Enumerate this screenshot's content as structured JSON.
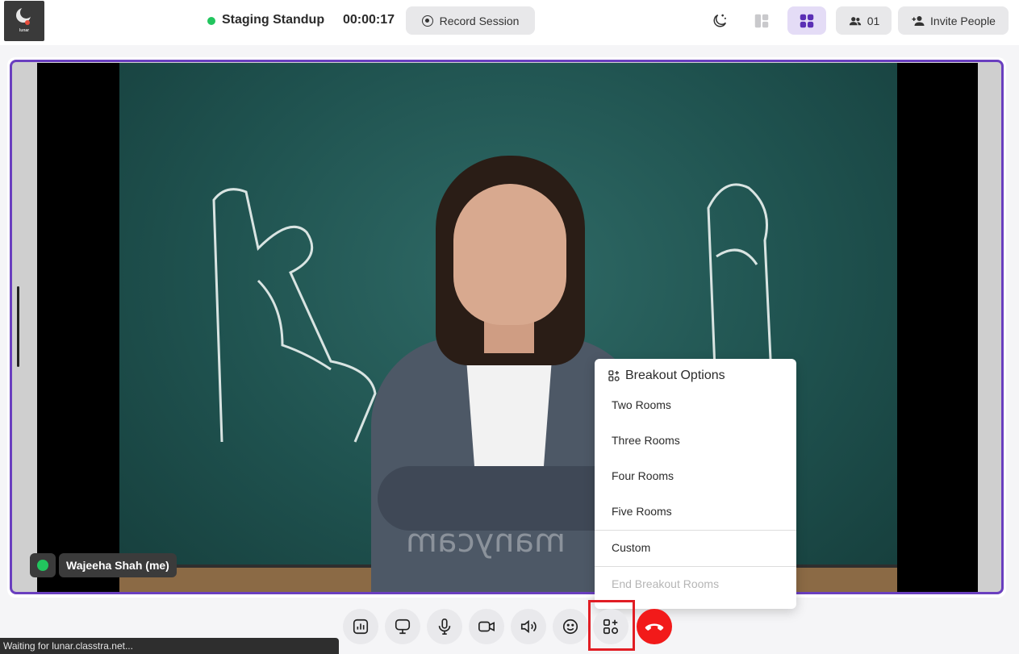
{
  "header": {
    "logo_text": "lunar",
    "meeting_title": "Staging Standup",
    "timer": "00:00:17",
    "record_label": "Record Session",
    "participants_count": "01",
    "invite_label": "Invite People"
  },
  "video": {
    "participant_name": "Wajeeha Shah (me)",
    "watermark": "manycam"
  },
  "breakout_menu": {
    "title": "Breakout Options",
    "items": [
      "Two Rooms",
      "Three Rooms",
      "Four Rooms",
      "Five Rooms"
    ],
    "custom": "Custom",
    "end": "End Breakout Rooms"
  },
  "toolbar": {
    "buttons": [
      "poll-icon",
      "screen-share-icon",
      "microphone-icon",
      "camera-icon",
      "speaker-icon",
      "emoji-icon",
      "breakout-icon",
      "end-call-icon"
    ]
  },
  "statusbar": {
    "text": "Waiting for lunar.classtra.net..."
  },
  "colors": {
    "accent": "#6a3fbf",
    "live": "#22c55e",
    "danger": "#f21a1a"
  }
}
